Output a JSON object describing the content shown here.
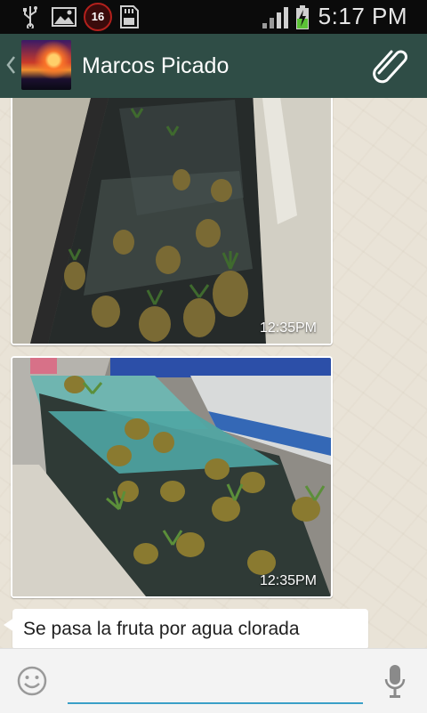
{
  "status_bar": {
    "notification_badge": "16",
    "time": "5:17 PM",
    "icons": [
      "usb-icon",
      "gallery-icon",
      "notification-badge",
      "sd-card-icon",
      "signal-icon",
      "battery-charging-icon"
    ]
  },
  "header": {
    "contact_name": "Marcos Picado",
    "icons": [
      "back-chevron-icon",
      "avatar",
      "attach-paperclip-icon"
    ]
  },
  "messages": [
    {
      "type": "image",
      "description_icon": "photo-pineapples-water-channel",
      "time": "12:35PM"
    },
    {
      "type": "image",
      "description_icon": "photo-pineapples-washing-conveyor",
      "time": "12:35PM"
    },
    {
      "type": "text",
      "text": "Se pasa la fruta por agua clorada"
    }
  ],
  "input_bar": {
    "placeholder": "",
    "value": "",
    "icons": [
      "emoji-icon",
      "microphone-icon"
    ]
  },
  "colors": {
    "action_bar": "#2f4d46",
    "status_bar": "#0b0b0b",
    "input_underline": "#3aa0c8",
    "chat_background": "#e9e3d7"
  }
}
